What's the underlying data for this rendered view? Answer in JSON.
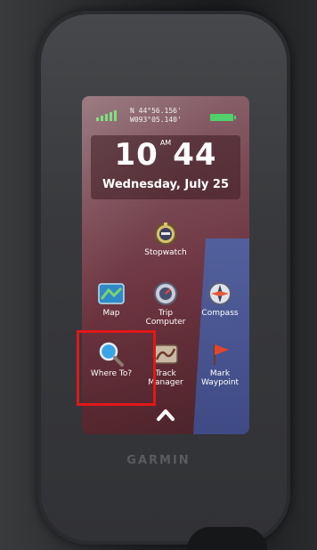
{
  "status": {
    "lat": "N 44°56.156'",
    "lon": "W093°05.140'"
  },
  "clock": {
    "hour": "10",
    "ampm": "AM",
    "minute": "44",
    "date": "Wednesday, July 25"
  },
  "apps": [
    {
      "label": "Stopwatch",
      "icon": "stopwatch-icon"
    },
    {
      "label": "Map",
      "icon": "map-icon"
    },
    {
      "label": "Trip Computer",
      "icon": "trip-computer-icon"
    },
    {
      "label": "Compass",
      "icon": "compass-icon"
    },
    {
      "label": "Where To?",
      "icon": "search-icon"
    },
    {
      "label": "Track Manager",
      "icon": "track-manager-icon"
    },
    {
      "label": "Mark Waypoint",
      "icon": "waypoint-flag-icon"
    }
  ],
  "brand": "GARMIN",
  "colors": {
    "highlight": "#e01818",
    "battery": "#4fd06a",
    "signal": "#7fe07f"
  }
}
